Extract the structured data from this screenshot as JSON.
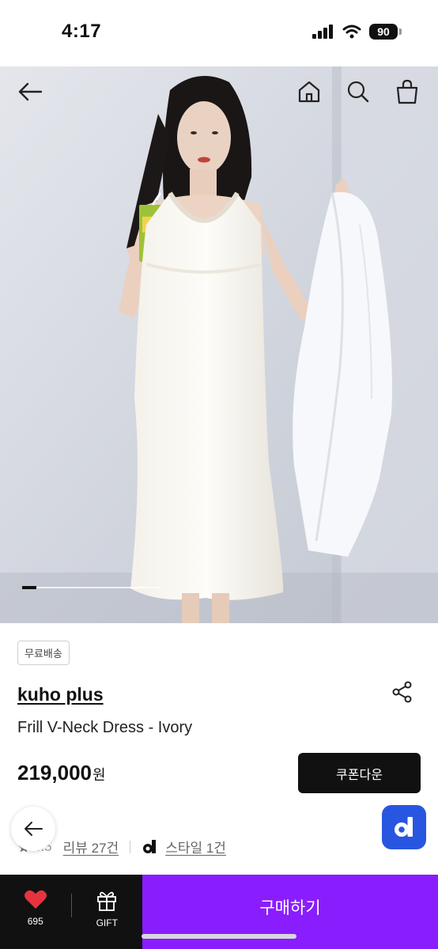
{
  "status_bar": {
    "time": "4:17",
    "battery": "90"
  },
  "hero": {
    "nav_icons": [
      "back-arrow-icon",
      "home-icon",
      "search-icon",
      "shopping-bag-icon"
    ],
    "image_progress": 0.1
  },
  "product": {
    "badge": "무료배송",
    "brand": "kuho plus",
    "name": "Frill V-Neck Dress - Ivory",
    "price": "219,000",
    "price_unit": "원",
    "coupon_label": "쿠폰다운"
  },
  "meta": {
    "rating": "4.5",
    "review_link": "리뷰 27건",
    "style_link": "스타일 1건"
  },
  "bottom_bar": {
    "like_count": "695",
    "gift_label": "GIFT",
    "buy_label": "구매하기"
  },
  "colors": {
    "buy": "#8a1dfe",
    "dark": "#111111",
    "brand_blue": "#2956e0"
  }
}
